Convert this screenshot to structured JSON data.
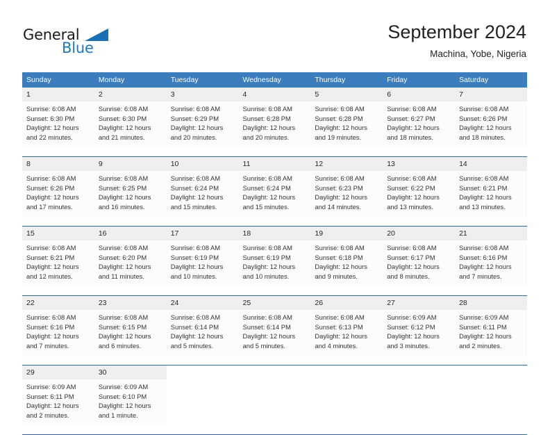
{
  "brand": {
    "line1": "General",
    "line2": "Blue",
    "flag_icon": "blue-triangle-flag",
    "accent_color": "#1f77c4"
  },
  "header": {
    "month_title": "September 2024",
    "location": "Machina, Yobe, Nigeria"
  },
  "calendar": {
    "header_bg": "#3b7dbd",
    "daynum_bg": "#efefef",
    "cell_bg": "#fcfcfc",
    "separator_color": "#2a6ca8",
    "weekday_headers": [
      "Sunday",
      "Monday",
      "Tuesday",
      "Wednesday",
      "Thursday",
      "Friday",
      "Saturday"
    ],
    "weeks": [
      [
        {
          "day": "1",
          "sunrise": "Sunrise: 6:08 AM",
          "sunset": "Sunset: 6:30 PM",
          "daylight1": "Daylight: 12 hours",
          "daylight2": "and 22 minutes."
        },
        {
          "day": "2",
          "sunrise": "Sunrise: 6:08 AM",
          "sunset": "Sunset: 6:30 PM",
          "daylight1": "Daylight: 12 hours",
          "daylight2": "and 21 minutes."
        },
        {
          "day": "3",
          "sunrise": "Sunrise: 6:08 AM",
          "sunset": "Sunset: 6:29 PM",
          "daylight1": "Daylight: 12 hours",
          "daylight2": "and 20 minutes."
        },
        {
          "day": "4",
          "sunrise": "Sunrise: 6:08 AM",
          "sunset": "Sunset: 6:28 PM",
          "daylight1": "Daylight: 12 hours",
          "daylight2": "and 20 minutes."
        },
        {
          "day": "5",
          "sunrise": "Sunrise: 6:08 AM",
          "sunset": "Sunset: 6:28 PM",
          "daylight1": "Daylight: 12 hours",
          "daylight2": "and 19 minutes."
        },
        {
          "day": "6",
          "sunrise": "Sunrise: 6:08 AM",
          "sunset": "Sunset: 6:27 PM",
          "daylight1": "Daylight: 12 hours",
          "daylight2": "and 18 minutes."
        },
        {
          "day": "7",
          "sunrise": "Sunrise: 6:08 AM",
          "sunset": "Sunset: 6:26 PM",
          "daylight1": "Daylight: 12 hours",
          "daylight2": "and 18 minutes."
        }
      ],
      [
        {
          "day": "8",
          "sunrise": "Sunrise: 6:08 AM",
          "sunset": "Sunset: 6:26 PM",
          "daylight1": "Daylight: 12 hours",
          "daylight2": "and 17 minutes."
        },
        {
          "day": "9",
          "sunrise": "Sunrise: 6:08 AM",
          "sunset": "Sunset: 6:25 PM",
          "daylight1": "Daylight: 12 hours",
          "daylight2": "and 16 minutes."
        },
        {
          "day": "10",
          "sunrise": "Sunrise: 6:08 AM",
          "sunset": "Sunset: 6:24 PM",
          "daylight1": "Daylight: 12 hours",
          "daylight2": "and 15 minutes."
        },
        {
          "day": "11",
          "sunrise": "Sunrise: 6:08 AM",
          "sunset": "Sunset: 6:24 PM",
          "daylight1": "Daylight: 12 hours",
          "daylight2": "and 15 minutes."
        },
        {
          "day": "12",
          "sunrise": "Sunrise: 6:08 AM",
          "sunset": "Sunset: 6:23 PM",
          "daylight1": "Daylight: 12 hours",
          "daylight2": "and 14 minutes."
        },
        {
          "day": "13",
          "sunrise": "Sunrise: 6:08 AM",
          "sunset": "Sunset: 6:22 PM",
          "daylight1": "Daylight: 12 hours",
          "daylight2": "and 13 minutes."
        },
        {
          "day": "14",
          "sunrise": "Sunrise: 6:08 AM",
          "sunset": "Sunset: 6:21 PM",
          "daylight1": "Daylight: 12 hours",
          "daylight2": "and 13 minutes."
        }
      ],
      [
        {
          "day": "15",
          "sunrise": "Sunrise: 6:08 AM",
          "sunset": "Sunset: 6:21 PM",
          "daylight1": "Daylight: 12 hours",
          "daylight2": "and 12 minutes."
        },
        {
          "day": "16",
          "sunrise": "Sunrise: 6:08 AM",
          "sunset": "Sunset: 6:20 PM",
          "daylight1": "Daylight: 12 hours",
          "daylight2": "and 11 minutes."
        },
        {
          "day": "17",
          "sunrise": "Sunrise: 6:08 AM",
          "sunset": "Sunset: 6:19 PM",
          "daylight1": "Daylight: 12 hours",
          "daylight2": "and 10 minutes."
        },
        {
          "day": "18",
          "sunrise": "Sunrise: 6:08 AM",
          "sunset": "Sunset: 6:19 PM",
          "daylight1": "Daylight: 12 hours",
          "daylight2": "and 10 minutes."
        },
        {
          "day": "19",
          "sunrise": "Sunrise: 6:08 AM",
          "sunset": "Sunset: 6:18 PM",
          "daylight1": "Daylight: 12 hours",
          "daylight2": "and 9 minutes."
        },
        {
          "day": "20",
          "sunrise": "Sunrise: 6:08 AM",
          "sunset": "Sunset: 6:17 PM",
          "daylight1": "Daylight: 12 hours",
          "daylight2": "and 8 minutes."
        },
        {
          "day": "21",
          "sunrise": "Sunrise: 6:08 AM",
          "sunset": "Sunset: 6:16 PM",
          "daylight1": "Daylight: 12 hours",
          "daylight2": "and 7 minutes."
        }
      ],
      [
        {
          "day": "22",
          "sunrise": "Sunrise: 6:08 AM",
          "sunset": "Sunset: 6:16 PM",
          "daylight1": "Daylight: 12 hours",
          "daylight2": "and 7 minutes."
        },
        {
          "day": "23",
          "sunrise": "Sunrise: 6:08 AM",
          "sunset": "Sunset: 6:15 PM",
          "daylight1": "Daylight: 12 hours",
          "daylight2": "and 6 minutes."
        },
        {
          "day": "24",
          "sunrise": "Sunrise: 6:08 AM",
          "sunset": "Sunset: 6:14 PM",
          "daylight1": "Daylight: 12 hours",
          "daylight2": "and 5 minutes."
        },
        {
          "day": "25",
          "sunrise": "Sunrise: 6:08 AM",
          "sunset": "Sunset: 6:14 PM",
          "daylight1": "Daylight: 12 hours",
          "daylight2": "and 5 minutes."
        },
        {
          "day": "26",
          "sunrise": "Sunrise: 6:08 AM",
          "sunset": "Sunset: 6:13 PM",
          "daylight1": "Daylight: 12 hours",
          "daylight2": "and 4 minutes."
        },
        {
          "day": "27",
          "sunrise": "Sunrise: 6:09 AM",
          "sunset": "Sunset: 6:12 PM",
          "daylight1": "Daylight: 12 hours",
          "daylight2": "and 3 minutes."
        },
        {
          "day": "28",
          "sunrise": "Sunrise: 6:09 AM",
          "sunset": "Sunset: 6:11 PM",
          "daylight1": "Daylight: 12 hours",
          "daylight2": "and 2 minutes."
        }
      ],
      [
        {
          "day": "29",
          "sunrise": "Sunrise: 6:09 AM",
          "sunset": "Sunset: 6:11 PM",
          "daylight1": "Daylight: 12 hours",
          "daylight2": "and 2 minutes."
        },
        {
          "day": "30",
          "sunrise": "Sunrise: 6:09 AM",
          "sunset": "Sunset: 6:10 PM",
          "daylight1": "Daylight: 12 hours",
          "daylight2": "and 1 minute."
        },
        null,
        null,
        null,
        null,
        null
      ]
    ]
  }
}
